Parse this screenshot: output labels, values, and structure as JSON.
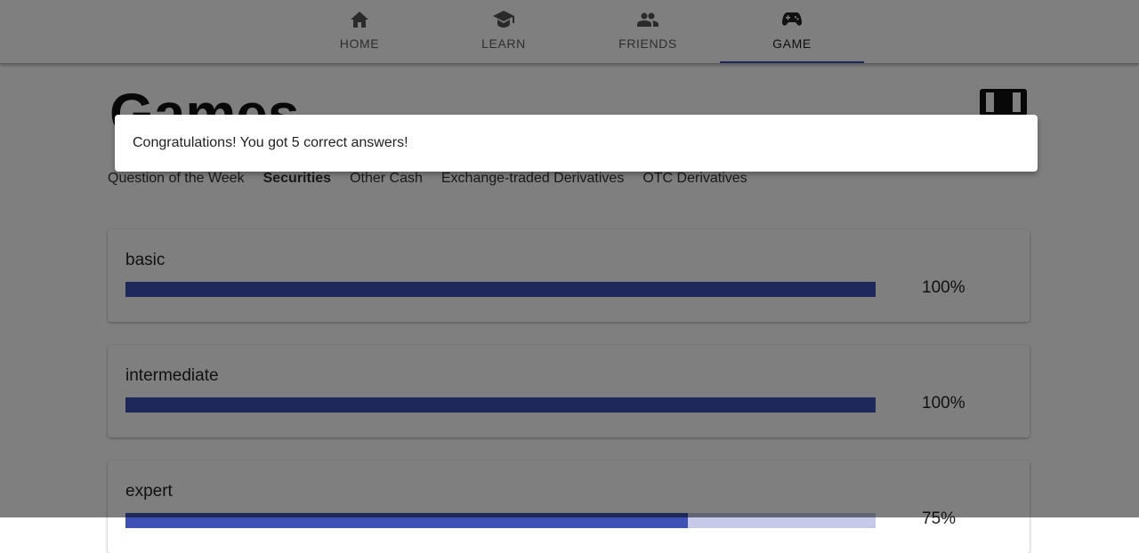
{
  "nav": {
    "items": [
      {
        "label": "HOME",
        "icon": "home-icon"
      },
      {
        "label": "LEARN",
        "icon": "graduation-cap-icon"
      },
      {
        "label": "FRIENDS",
        "icon": "people-icon"
      },
      {
        "label": "GAME",
        "icon": "gamepad-icon"
      }
    ],
    "active": "GAME"
  },
  "page": {
    "title": "Games",
    "tabs": [
      "Question of the Week",
      "Securities",
      "Other Cash",
      "Exchange-traded Derivatives",
      "OTC Derivatives"
    ],
    "active_tab": "Securities"
  },
  "levels": [
    {
      "name": "basic",
      "progress": 1.0,
      "percent_label": "100%"
    },
    {
      "name": "intermediate",
      "progress": 1.0,
      "percent_label": "100%"
    },
    {
      "name": "expert",
      "progress": 0.75,
      "percent_label": "75%"
    }
  ],
  "snackbar": {
    "message": "Congratulations! You got 5 correct answers!"
  },
  "colors": {
    "accent": "#3f51b5",
    "track": "#c5cae9",
    "overlay": "rgba(0,0,0,0.5)"
  }
}
